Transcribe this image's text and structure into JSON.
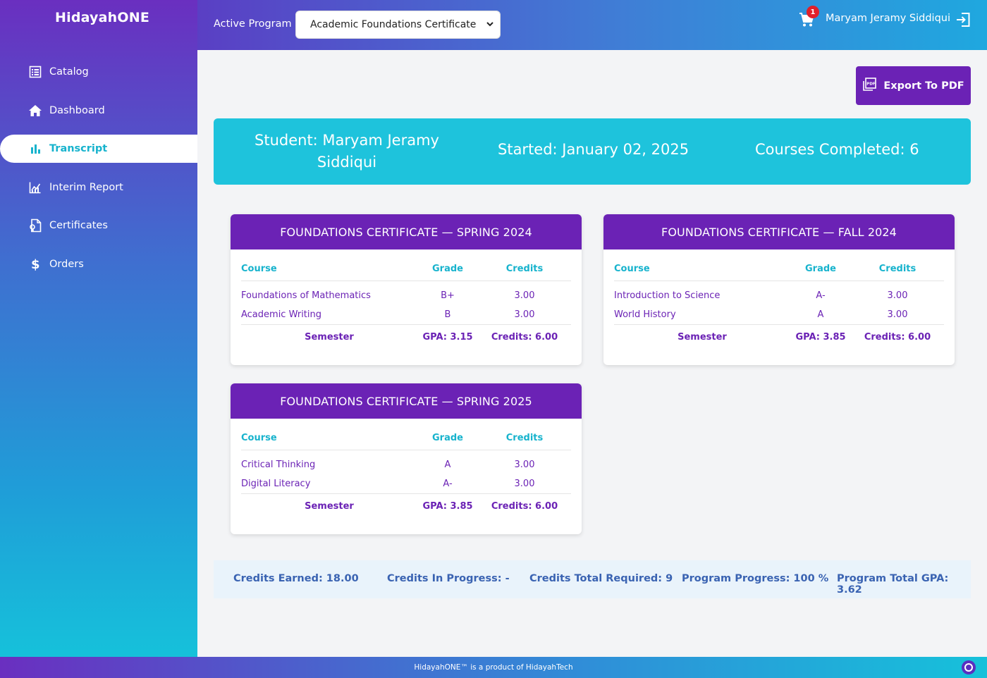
{
  "app": {
    "brand": "HidayahONE"
  },
  "sidebar": {
    "items": [
      {
        "label": "Catalog",
        "icon": "catalog-icon"
      },
      {
        "label": "Dashboard",
        "icon": "home-icon"
      },
      {
        "label": "Transcript",
        "icon": "bar-chart-icon",
        "active": true
      },
      {
        "label": "Interim Report",
        "icon": "line-chart-icon"
      },
      {
        "label": "Certificates",
        "icon": "certificate-icon"
      },
      {
        "label": "Orders",
        "icon": "dollar-icon"
      }
    ]
  },
  "header": {
    "active_program_label": "Active Program",
    "program_selected": "Academic Foundations Certificate",
    "cart_count": "1",
    "user_name": "Maryam Jeramy Siddiqui"
  },
  "main": {
    "export_label": "Export To PDF",
    "banner": {
      "student": "Student: Maryam Jeramy Siddiqui",
      "started": "Started: January 02, 2025",
      "completed": "Courses Completed: 6"
    },
    "table_headers": {
      "course": "Course",
      "grade": "Grade",
      "credits": "Credits"
    },
    "semesters": [
      {
        "title": "FOUNDATIONS CERTIFICATE — SPRING 2024",
        "rows": [
          {
            "course": "Foundations of Mathematics",
            "grade": "B+",
            "credits": "3.00"
          },
          {
            "course": "Academic Writing",
            "grade": "B",
            "credits": "3.00"
          }
        ],
        "summary": {
          "label": "Semester",
          "gpa": "GPA: 3.15",
          "credits": "Credits: 6.00"
        }
      },
      {
        "title": "FOUNDATIONS CERTIFICATE — FALL 2024",
        "rows": [
          {
            "course": "Introduction to Science",
            "grade": "A-",
            "credits": "3.00"
          },
          {
            "course": "World History",
            "grade": "A",
            "credits": "3.00"
          }
        ],
        "summary": {
          "label": "Semester",
          "gpa": "GPA: 3.85",
          "credits": "Credits: 6.00"
        }
      },
      {
        "title": "FOUNDATIONS CERTIFICATE — SPRING 2025",
        "rows": [
          {
            "course": "Critical Thinking",
            "grade": "A",
            "credits": "3.00"
          },
          {
            "course": "Digital Literacy",
            "grade": "A-",
            "credits": "3.00"
          }
        ],
        "summary": {
          "label": "Semester",
          "gpa": "GPA: 3.85",
          "credits": "Credits: 6.00"
        }
      }
    ],
    "summary": {
      "earned": "Credits Earned: 18.00",
      "in_progress": "Credits In Progress: -",
      "required": "Credits Total Required: 9",
      "progress": "Program Progress: 100 %",
      "gpa": "Program Total GPA: 3.62"
    }
  },
  "footer": {
    "text": "HidayahONE™ is a product of HidayahTech"
  },
  "colors": {
    "purple": "#6b22b5",
    "cyan": "#1ec3dc",
    "accent_text": "#17b3cd"
  }
}
